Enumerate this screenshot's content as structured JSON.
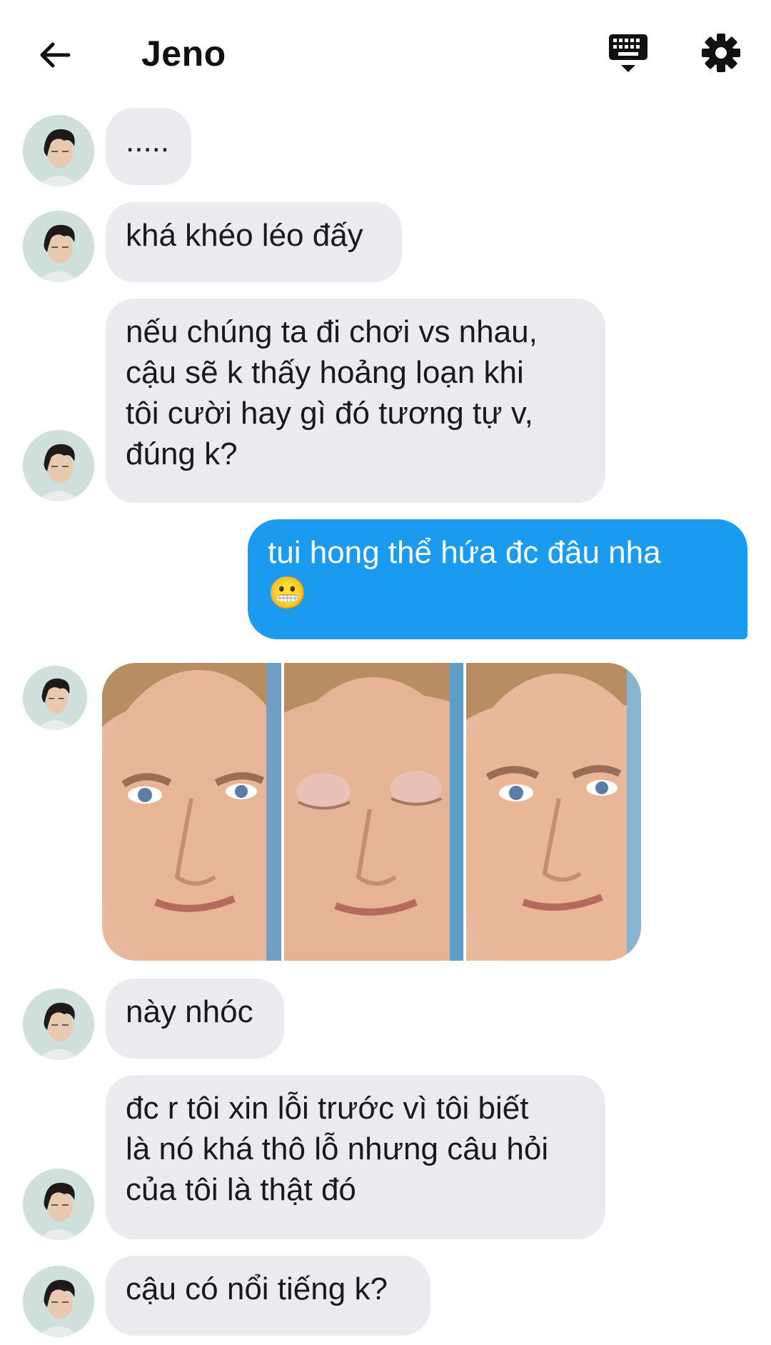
{
  "header": {
    "title": "Jeno",
    "back_icon": "arrow-left-icon",
    "keyboard_icon": "keyboard-icon",
    "settings_icon": "gear-icon"
  },
  "colors": {
    "incoming_bubble": "#e9ebee",
    "outgoing_bubble": "#1a9bef",
    "background": "#ffffff"
  },
  "messages": [
    {
      "sender": "Jeno",
      "type": "text",
      "text": "....."
    },
    {
      "sender": "Jeno",
      "type": "text",
      "text": "khá khéo léo đấy"
    },
    {
      "sender": "Jeno",
      "type": "text",
      "text": "nếu chúng ta đi chơi vs nhau,\ncậu sẽ k thấy hoảng loạn khi\ntôi cười hay gì đó tương tự v,\nđúng k?"
    },
    {
      "sender": "me",
      "type": "text",
      "text": "tui hong thể hứa đc đâu nha\n😬"
    },
    {
      "sender": "Jeno",
      "type": "image",
      "image": "blinking-man-meme-three-panels"
    },
    {
      "sender": "Jeno",
      "type": "text",
      "text": "này nhóc"
    },
    {
      "sender": "Jeno",
      "type": "text",
      "text": "đc r tôi xin lỗi trước vì tôi biết\nlà nó khá thô lỗ nhưng câu hỏi\ncủa tôi là thật đó"
    },
    {
      "sender": "Jeno",
      "type": "text",
      "text": "cậu có nổi tiếng k?"
    }
  ]
}
